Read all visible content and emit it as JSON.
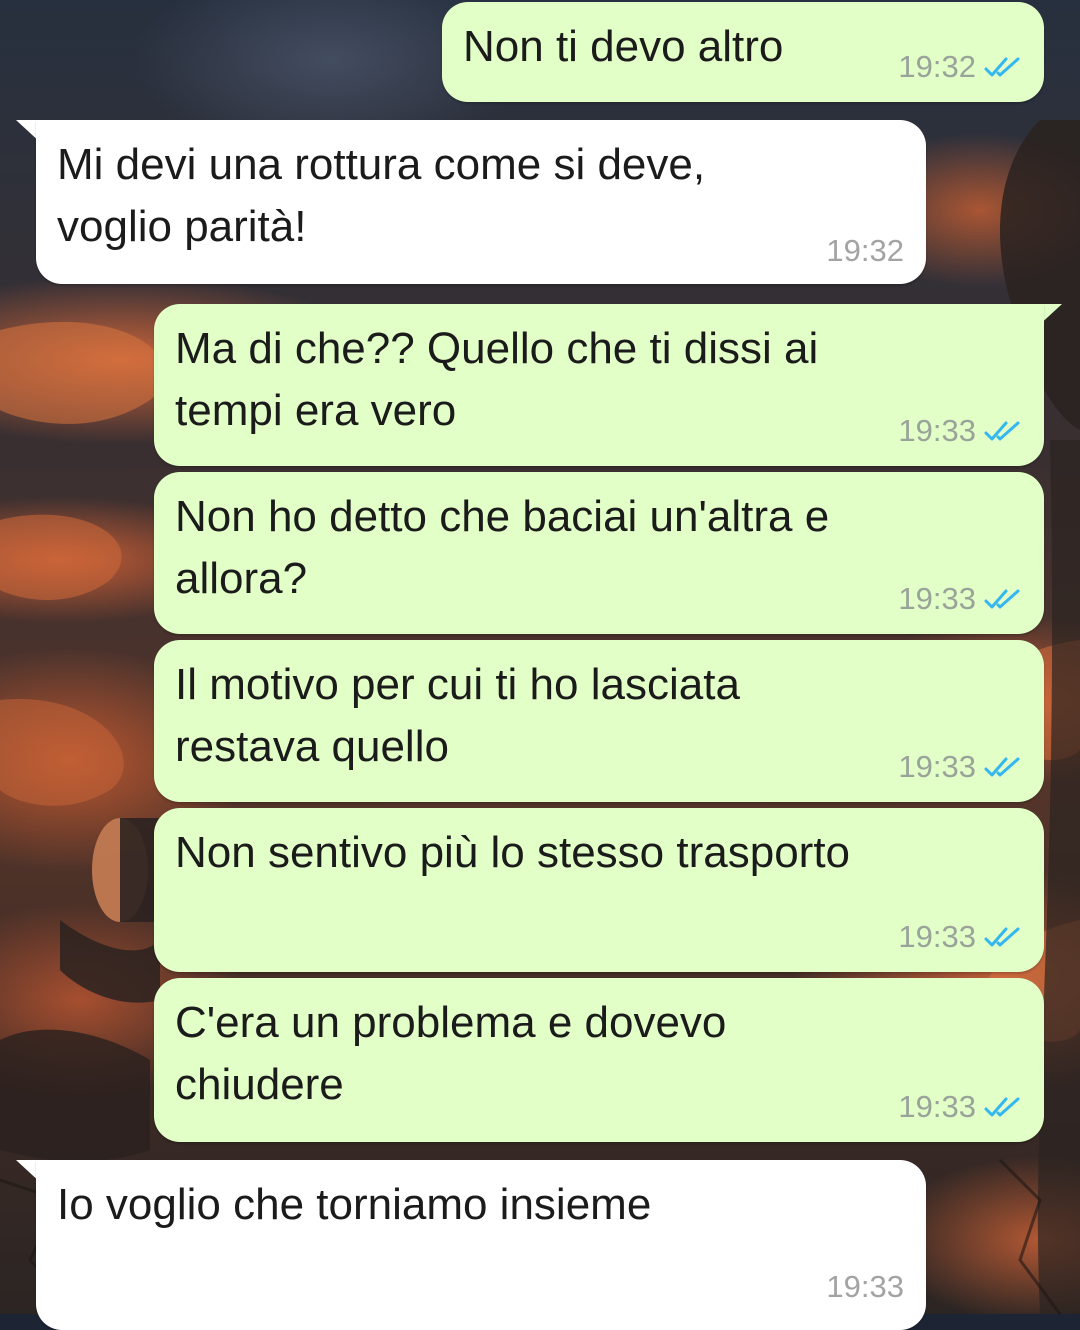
{
  "theme": {
    "outgoing_bubble": "#e2ffc7",
    "incoming_bubble": "#ffffff",
    "read_tick_color": "#34b7f1",
    "timestamp_color": "#9aa39a"
  },
  "messages": [
    {
      "direction": "outgoing",
      "text": "Non ti devo altro",
      "time": "19:32",
      "status": "read",
      "status_icon": "double-check-icon"
    },
    {
      "direction": "incoming",
      "text": "Mi devi una rottura come si deve,\nvoglio parità!",
      "time": "19:32"
    },
    {
      "direction": "outgoing",
      "text": "Ma di che?? Quello che ti dissi ai\ntempi era vero",
      "time": "19:33",
      "status": "read",
      "status_icon": "double-check-icon"
    },
    {
      "direction": "outgoing",
      "text": "Non ho detto che baciai un'altra e\nallora?",
      "time": "19:33",
      "status": "read",
      "status_icon": "double-check-icon"
    },
    {
      "direction": "outgoing",
      "text": "Il motivo per cui ti ho lasciata\nrestava quello",
      "time": "19:33",
      "status": "read",
      "status_icon": "double-check-icon"
    },
    {
      "direction": "outgoing",
      "text": "Non sentivo più lo stesso trasporto",
      "time": "19:33",
      "status": "read",
      "status_icon": "double-check-icon"
    },
    {
      "direction": "outgoing",
      "text": "C'era un problema e dovevo\nchiudere",
      "time": "19:33",
      "status": "read",
      "status_icon": "double-check-icon"
    },
    {
      "direction": "incoming",
      "text": "Io voglio che torniamo insieme",
      "time": "19:33"
    }
  ]
}
